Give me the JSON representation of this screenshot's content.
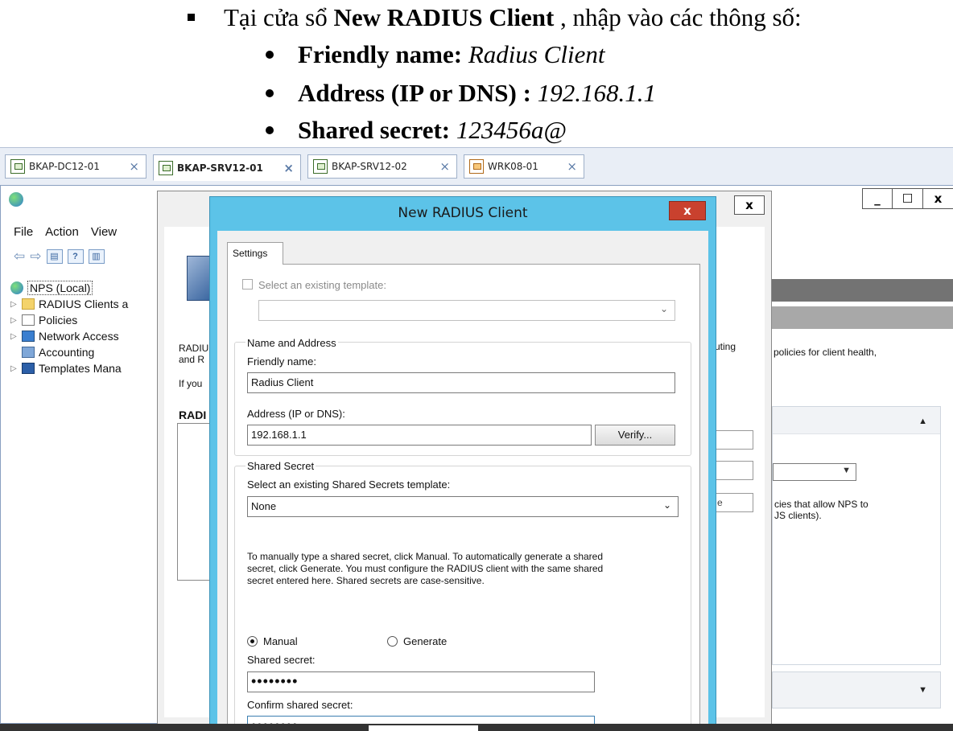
{
  "doc": {
    "line0": {
      "prefix": "Tại cửa sổ ",
      "bold": "New RADIUS Client",
      "suffix": " , nhập vào các thông số:"
    },
    "bullets": [
      {
        "label": "Friendly name:",
        "value": " Radius Client"
      },
      {
        "label": "Address (IP or DNS) :",
        "value": " 192.168.1.1"
      },
      {
        "label": "Shared secret:",
        "value": " 123456a@"
      }
    ]
  },
  "tabs": [
    {
      "label": "BKAP-DC12-01",
      "close": "×",
      "active": false,
      "icon": "vm-icon"
    },
    {
      "label": "BKAP-SRV12-01",
      "close": "×",
      "active": true,
      "icon": "vm-icon"
    },
    {
      "label": "BKAP-SRV12-02",
      "close": "×",
      "active": false,
      "icon": "vm-icon"
    },
    {
      "label": "WRK08-01",
      "close": "×",
      "active": false,
      "icon": "vm-icon"
    }
  ],
  "mmc": {
    "menu": [
      "File",
      "Action",
      "View"
    ],
    "window_buttons": [
      "_",
      "☐",
      "x"
    ],
    "tree": [
      {
        "label": "NPS (Local)",
        "icon": "nps-icon"
      },
      {
        "label": "RADIUS Clients a",
        "icon": "folder-icon"
      },
      {
        "label": "Policies",
        "icon": "policy-icon"
      },
      {
        "label": "Network Access",
        "icon": "network-access-icon"
      },
      {
        "label": "Accounting",
        "icon": "accounting-icon"
      },
      {
        "label": "Templates Mana",
        "icon": "templates-icon"
      }
    ],
    "right_text_1": "policies for client health,",
    "right_text_2": "cies that allow NPS to",
    "right_text_3": "JS clients)."
  },
  "props": {
    "close": "x",
    "text_radiu": "RADIU",
    "text_andr": "and R",
    "text_ifyou": "If you",
    "text_radi_bold": "RADI",
    "text_outing": "uting",
    "ghost_e": "e"
  },
  "dialog": {
    "title": "New RADIUS Client",
    "close": "x",
    "tab": "Settings",
    "template_checkbox_label": "Select an existing template:",
    "template_value": "",
    "group_name_address": "Name and Address",
    "friendly_name_label": "Friendly name:",
    "friendly_name_value": "Radius Client",
    "address_label": "Address (IP or DNS):",
    "address_value": "192.168.1.1",
    "verify_button": "Verify...",
    "group_shared_secret": "Shared Secret",
    "secret_template_label": "Select an existing Shared Secrets template:",
    "secret_template_value": "None",
    "help_line1": "To manually type a shared secret, click Manual. To automatically generate a shared",
    "help_line2": "secret, click Generate. You must configure the RADIUS client with the same shared",
    "help_line3": "secret entered here. Shared secrets are case-sensitive.",
    "radio_manual": "Manual",
    "radio_generate": "Generate",
    "shared_secret_label": "Shared secret:",
    "shared_secret_value": "••••••••",
    "confirm_label": "Confirm shared secret:",
    "confirm_value": "••••••••"
  }
}
